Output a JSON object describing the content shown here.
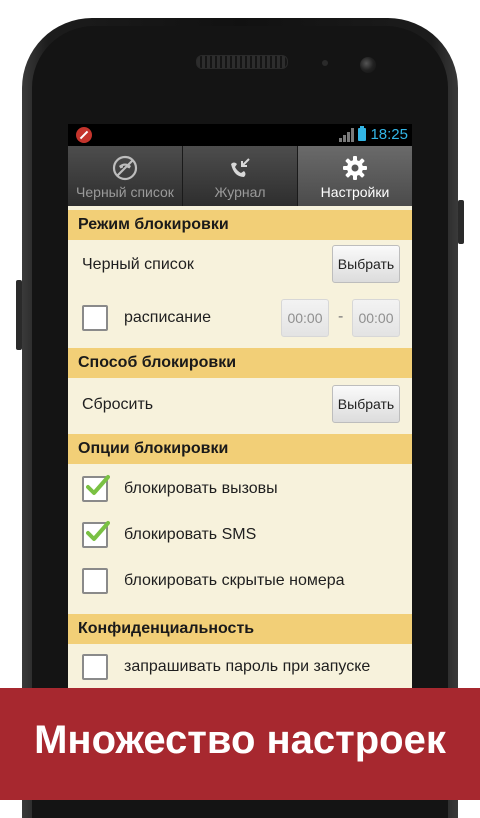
{
  "statusbar": {
    "time": "18:25"
  },
  "tabs": [
    {
      "label": "Черный список",
      "icon": "blocked-phone-icon",
      "active": false
    },
    {
      "label": "Журнал",
      "icon": "call-log-icon",
      "active": false
    },
    {
      "label": "Настройки",
      "icon": "gear-icon",
      "active": true
    }
  ],
  "sections": {
    "block_mode": {
      "title": "Режим блокировки",
      "list_label": "Черный список",
      "choose_button": "Выбрать",
      "schedule_label": "расписание",
      "time_from": "00:00",
      "time_separator": "-",
      "time_to": "00:00"
    },
    "block_method": {
      "title": "Способ блокировки",
      "method_label": "Сбросить",
      "choose_button": "Выбрать"
    },
    "block_options": {
      "title": "Опции блокировки",
      "items": [
        {
          "label": "блокировать вызовы",
          "checked": true
        },
        {
          "label": "блокировать SMS",
          "checked": true
        },
        {
          "label": "блокировать скрытые номера",
          "checked": false
        }
      ]
    },
    "privacy": {
      "title": "Конфиденциальность",
      "items": [
        {
          "label": "запрашивать пароль при запуске",
          "checked": false
        }
      ]
    }
  },
  "banner": {
    "text": "Множество настроек"
  },
  "colors": {
    "accent": "#33b5e5",
    "header": "#f2cf77",
    "content_bg": "#f7f2dc",
    "banner": "#a7282f",
    "check": "#7ac143"
  }
}
